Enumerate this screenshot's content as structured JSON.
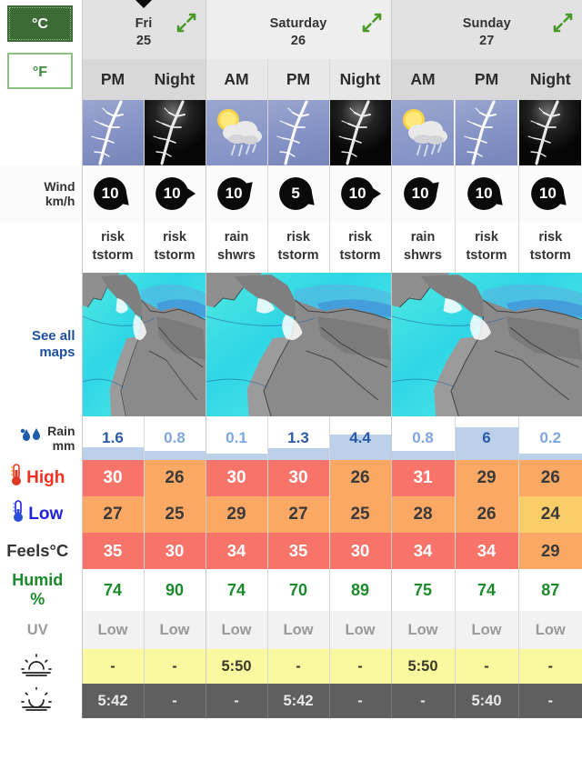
{
  "units": {
    "active": "°C",
    "inactive": "°F",
    "active_name": "celsius",
    "inactive_name": "fahrenheit"
  },
  "sidebar_labels": {
    "wind": "Wind",
    "wind_unit": "km/h",
    "see_all_maps_1": "See all",
    "see_all_maps_2": "maps",
    "rain": "Rain",
    "rain_unit": "mm",
    "high": "High",
    "low": "Low",
    "feels": "Feels°C",
    "humid": "Humid",
    "humid_unit": "%",
    "uv": "UV"
  },
  "days": [
    {
      "name": "Fri",
      "date": "25",
      "slots": [
        "PM",
        "Night"
      ],
      "shaded": true
    },
    {
      "name": "Saturday",
      "date": "26",
      "slots": [
        "AM",
        "PM",
        "Night"
      ],
      "shaded": false
    },
    {
      "name": "Sunday",
      "date": "27",
      "slots": [
        "AM",
        "PM",
        "Night"
      ],
      "shaded": true
    }
  ],
  "columns": [
    {
      "day": "Fri",
      "slot": "PM",
      "icon": "thunderstorm-day",
      "cond_line1": "risk",
      "cond_line2": "tstorm",
      "wind": "10",
      "wind_dir": "se",
      "rain": "1.6",
      "rain_emph": true,
      "high": "30",
      "high_level": "hot",
      "low": "27",
      "low_level": "warm",
      "feels": "35",
      "feels_level": "hot",
      "humidity": "74",
      "uv": "Low",
      "sunrise": "-",
      "sunset": "5:42"
    },
    {
      "day": "Fri",
      "slot": "Night",
      "icon": "thunderstorm-night",
      "cond_line1": "risk",
      "cond_line2": "tstorm",
      "wind": "10",
      "wind_dir": "e",
      "rain": "0.8",
      "rain_emph": false,
      "high": "26",
      "high_level": "warm",
      "low": "25",
      "low_level": "warm",
      "feels": "30",
      "feels_level": "hot",
      "humidity": "90",
      "uv": "Low",
      "sunrise": "-",
      "sunset": "-"
    },
    {
      "day": "Saturday",
      "slot": "AM",
      "icon": "sun-cloud-rain",
      "cond_line1": "rain",
      "cond_line2": "shwrs",
      "wind": "10",
      "wind_dir": "ne",
      "rain": "0.1",
      "rain_emph": false,
      "high": "30",
      "high_level": "hot",
      "low": "29",
      "low_level": "warm",
      "feels": "34",
      "feels_level": "hot",
      "humidity": "74",
      "uv": "Low",
      "sunrise": "5:50",
      "sunset": "-"
    },
    {
      "day": "Saturday",
      "slot": "PM",
      "icon": "thunderstorm-day",
      "cond_line1": "risk",
      "cond_line2": "tstorm",
      "wind": "5",
      "wind_dir": "se",
      "rain": "1.3",
      "rain_emph": true,
      "high": "30",
      "high_level": "hot",
      "low": "27",
      "low_level": "warm",
      "feels": "35",
      "feels_level": "hot",
      "humidity": "70",
      "uv": "Low",
      "sunrise": "-",
      "sunset": "5:42"
    },
    {
      "day": "Saturday",
      "slot": "Night",
      "icon": "thunderstorm-night",
      "cond_line1": "risk",
      "cond_line2": "tstorm",
      "wind": "10",
      "wind_dir": "e",
      "rain": "4.4",
      "rain_emph": true,
      "high": "26",
      "high_level": "warm",
      "low": "25",
      "low_level": "warm",
      "feels": "30",
      "feels_level": "hot",
      "humidity": "89",
      "uv": "Low",
      "sunrise": "-",
      "sunset": "-"
    },
    {
      "day": "Sunday",
      "slot": "AM",
      "icon": "sun-cloud-rain",
      "cond_line1": "rain",
      "cond_line2": "shwrs",
      "wind": "10",
      "wind_dir": "ne",
      "rain": "0.8",
      "rain_emph": false,
      "high": "31",
      "high_level": "hot",
      "low": "28",
      "low_level": "warm",
      "feels": "34",
      "feels_level": "hot",
      "humidity": "75",
      "uv": "Low",
      "sunrise": "5:50",
      "sunset": "-"
    },
    {
      "day": "Sunday",
      "slot": "PM",
      "icon": "thunderstorm-day",
      "cond_line1": "risk",
      "cond_line2": "tstorm",
      "wind": "10",
      "wind_dir": "se",
      "rain": "6",
      "rain_emph": true,
      "high": "29",
      "high_level": "warm",
      "low": "26",
      "low_level": "warm",
      "feels": "34",
      "feels_level": "hot",
      "humidity": "74",
      "uv": "Low",
      "sunrise": "-",
      "sunset": "5:40"
    },
    {
      "day": "Sunday",
      "slot": "Night",
      "icon": "thunderstorm-night",
      "cond_line1": "risk",
      "cond_line2": "tstorm",
      "wind": "10",
      "wind_dir": "se",
      "rain": "0.2",
      "rain_emph": false,
      "high": "26",
      "high_level": "warm",
      "low": "24",
      "low_level": "mild",
      "feels": "29",
      "feels_level": "warm",
      "humidity": "87",
      "uv": "Low",
      "sunrise": "-",
      "sunset": "-"
    }
  ],
  "colors": {
    "hot": "#f8746a",
    "warm": "#fba864",
    "mild": "#fbcd68",
    "rain_bar": "#bcd0ea",
    "rain_text_strong": "#2a5aa8",
    "rain_text_light": "#7fa6e0",
    "humid_text": "#1b8a2b",
    "link_blue": "#1e4f9c",
    "sunrise_bg": "#fbf9a0",
    "sunset_bg": "#5f5f5f",
    "unit_active_bg": "#3d6b36",
    "unit_border": "#8cc07e",
    "high_label": "#ee3322",
    "low_label": "#2222dd"
  },
  "icon_names": {
    "expand": "expand-arrows-icon",
    "raindrops": "raindrops-icon",
    "thermometer_high": "thermometer-hot-icon",
    "thermometer_low": "thermometer-cold-icon",
    "sunrise": "sunrise-icon",
    "sunset": "sunset-icon"
  }
}
